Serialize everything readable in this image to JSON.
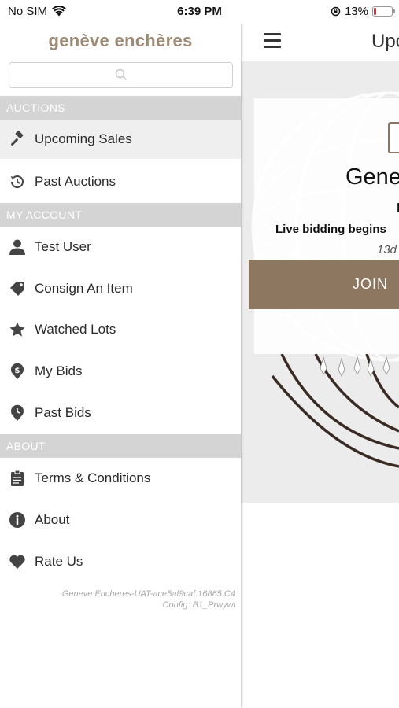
{
  "status_bar": {
    "carrier": "No SIM",
    "time": "6:39 PM",
    "battery_percent": "13%",
    "battery_level": 0.13,
    "battery_color": "#e0303a"
  },
  "drawer": {
    "brand": "genève enchères",
    "search": {
      "placeholder": "",
      "icon": "search-icon"
    },
    "sections": {
      "auctions": "AUCTIONS",
      "my_account": "MY ACCOUNT",
      "about": "ABOUT"
    },
    "items": {
      "upcoming_sales": {
        "label": "Upcoming Sales",
        "icon": "gavel-icon",
        "active": true
      },
      "past_auctions": {
        "label": "Past Auctions",
        "icon": "history-icon"
      },
      "test_user": {
        "label": "Test User",
        "icon": "user-icon"
      },
      "consign_item": {
        "label": "Consign An Item",
        "icon": "tag-icon"
      },
      "watched_lots": {
        "label": "Watched Lots",
        "icon": "star-icon"
      },
      "my_bids": {
        "label": "My Bids",
        "icon": "dollar-pin-icon"
      },
      "past_bids": {
        "label": "Past Bids",
        "icon": "clock-pin-icon"
      },
      "terms": {
        "label": "Terms & Conditions",
        "icon": "clipboard-icon"
      },
      "about": {
        "label": "About",
        "icon": "info-icon"
      },
      "rate_us": {
        "label": "Rate Us",
        "icon": "heart-icon"
      }
    },
    "version": {
      "line1": "Geneve Encheres-UAT-ace5af9caf.16865.C4",
      "line2": "Config: B1_Prwywl"
    }
  },
  "content": {
    "menu_icon": "hamburger-icon",
    "title": "Upco",
    "card": {
      "title": "Gene",
      "small": "l",
      "live_text": "Live bidding begins",
      "countdown": "13d",
      "join_label": "JOIN"
    },
    "accent_color": "#8e7761"
  }
}
